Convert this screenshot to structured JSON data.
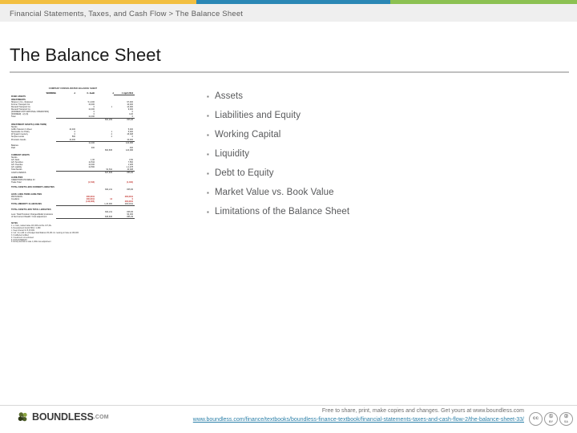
{
  "topbar": {
    "segments": [
      {
        "name": "yellow",
        "color": "#f2bf41"
      },
      {
        "name": "blue",
        "color": "#2b87b5"
      },
      {
        "name": "green",
        "color": "#8cc152"
      }
    ]
  },
  "breadcrumb": {
    "text": "Financial Statements, Taxes, and Cash Flow > The Balance Sheet"
  },
  "page_title": "The Balance Sheet",
  "bullets": [
    {
      "marker": "▪",
      "label": "Assets"
    },
    {
      "marker": "▪",
      "label": "Liabilities and Equity"
    },
    {
      "marker": "▪",
      "label": "Working Capital"
    },
    {
      "marker": "▪",
      "label": "Liquidity"
    },
    {
      "marker": "▪",
      "label": "Debt to Equity"
    },
    {
      "marker": "▪",
      "label": "Market Value vs. Book Value"
    },
    {
      "marker": "▪",
      "label": "Limitations of the Balance Sheet"
    }
  ],
  "figure": {
    "caption": "COMPANY CONSOLIDATED BALANCE SHEET",
    "column_headers": {
      "label": "WORKING",
      "c1": "£",
      "c2": "C. Audit",
      "c3": "£",
      "c4": "1 April 2014"
    },
    "sections": [
      {
        "heading": "FIXED ASSETS",
        "rows": [
          {
            "label": "INVESTMENTS",
            "c1": "",
            "c2": "",
            "c3": "",
            "c4": "",
            "bold": true
          },
          {
            "label": "Shares in Co - Reduced",
            "c1": "",
            "c2": "5,1,400",
            "c3": "",
            "c4": "97,400"
          },
          {
            "label": "Former Transport Co.",
            "c1": "",
            "c2": "12,400",
            "c3": "",
            "c4": "10,400"
          },
          {
            "label": "Renault Transport Co.",
            "c1": "",
            "c2": "0",
            "c3": "1",
            "c4": "14,000"
          },
          {
            "label": "Renault Transport Co.",
            "c1": "",
            "c2": "12,400",
            "c3": "",
            "c4": "9,400"
          },
          {
            "label": "[FORMER UNIT RATIONAL OPERATION]",
            "c1": "",
            "c2": "0",
            "c3": "",
            "c4": "0"
          },
          {
            "label": "[FORMER] - (2) (3)",
            "c1": "",
            "c2": "0",
            "c3": "",
            "c4": "0,20"
          },
          {
            "label": "Total",
            "c1": "",
            "c2": "12,400",
            "c3": "",
            "c4": "0",
            "underline": true
          },
          {
            "label": "",
            "c1": "",
            "c2": "",
            "c3": "804,299",
            "c4": "805,98"
          }
        ]
      },
      {
        "heading": "INVESTMENT ASSETS (LONG TERM)",
        "rows": [
          {
            "label": "Stocks",
            "c1": "",
            "c2": "",
            "c3": "",
            "c4": ""
          },
          {
            "label": "Griffin Telecom In Fleet",
            "c1": "10,400",
            "c2": "",
            "c3": "",
            "c4": "5,400"
          },
          {
            "label": "Newcastle Inv Policy",
            "c1": "0",
            "c2": "",
            "c3": "1",
            "c4": "5,400"
          },
          {
            "label": "W Quant Inventory",
            "c1": "0",
            "c2": "",
            "c3": "2",
            "c4": "15,008"
          },
          {
            "label": "Surplus Lands",
            "c1": "500",
            "c2": "",
            "c3": "2",
            "c4": "0"
          },
          {
            "label": "Provision Goods",
            "c1": "12,400",
            "c2": "",
            "c3": "",
            "c4": "10,400",
            "underline": true
          },
          {
            "label": "",
            "c1": "",
            "c2": "11,400",
            "c3": "",
            "c4": "124,096"
          },
          {
            "label": "Balance",
            "c1": "",
            "c2": "",
            "c3": "",
            "c4": ""
          },
          {
            "label": "Paid",
            "c1": "",
            "c2": "400",
            "c3": "",
            "c4": "400"
          },
          {
            "label": "",
            "c1": "",
            "c2": "",
            "c3": "804,845",
            "c4": "124,096"
          }
        ]
      },
      {
        "heading": "CURRENT ASSETS",
        "rows": [
          {
            "label": "Stocks",
            "c1": "",
            "c2": "",
            "c3": "",
            "c4": ""
          },
          {
            "label": "A/C Debt",
            "c1": "",
            "c2": "1,00",
            "c3": "",
            "c4": "0,50"
          },
          {
            "label": "A/C Sundries",
            "c1": "",
            "c2": "11,544",
            "c3": "",
            "c4": "7,500"
          },
          {
            "label": "A/C Overdue",
            "c1": "",
            "c2": "12,400",
            "c3": "",
            "c4": "1,025"
          },
          {
            "label": "A/C Liability",
            "c1": "",
            "c2": "12,500",
            "c3": "",
            "c4": "1,1,278"
          },
          {
            "label": "Total Stocks",
            "c1": "",
            "c2": "",
            "c3": "91,811",
            "c4": "10,008",
            "underline": true
          },
          {
            "label": "CASH & BANKS",
            "c1": "",
            "c2": "",
            "c3": "847,845",
            "c4": "855,96"
          }
        ]
      },
      {
        "heading": "LIABILITIES",
        "rows": [
          {
            "label": "CREDITORS PAYABLE IN",
            "c1": "",
            "c2": "",
            "c3": "",
            "c4": ""
          },
          {
            "label": "Trade Total",
            "c1": "",
            "c2": "(1,544)",
            "c3": "",
            "c4": "(1,404)",
            "red": true
          }
        ]
      },
      {
        "heading": "TOTAL ASSETS LESS CURRENT LIABILITIES",
        "rows": [
          {
            "label": "",
            "c1": "",
            "c2": "",
            "c3": "824,211",
            "c4": "845,96",
            "bold": true
          }
        ]
      },
      {
        "heading": "LESS: LONG TERM LIABILITIES",
        "rows": [
          {
            "label": "PROVISION",
            "c1": "",
            "c2": "200,0011",
            "c3": "",
            "c4": "200,0011",
            "red": true
          },
          {
            "label": "Creditors",
            "c1": "",
            "c2": "200,0011",
            "c3": "14",
            "c4": "0",
            "red": true
          },
          {
            "label": "",
            "c1": "",
            "c2": "(140,005)",
            "c3": "",
            "c4": "200,0011",
            "red": true
          },
          {
            "label": "TOTAL MINORITY CLAIM BASIS",
            "c1": "",
            "c2": "",
            "c3": "1,20,000",
            "c4": "200,0011",
            "bold": true,
            "underline": true
          }
        ]
      },
      {
        "heading": "TOTAL ASSETS LESS TOTAL LIABILITIES",
        "rows": [
          {
            "label": "",
            "c1": "",
            "c2": "",
            "c3": "824,211",
            "c4": "845,96",
            "bold": true
          },
          {
            "label": "Less: Total Provision Charges/Relief provisions",
            "c1": "",
            "c2": "",
            "c3": "",
            "c4": "90,182"
          },
          {
            "label": "of Net Current Wealth / Cost adjustment",
            "c1": "",
            "c2": "",
            "c3": "845,845",
            "c4": "855,45",
            "underline": true
          }
        ]
      }
    ],
    "notes_heading": "NOTES",
    "notes": [
      "1.  a.  Cars, related value 116,400 and the 417,20+",
      "        b.  Development bonds 500u / 1,399",
      "        c.  Keep interest for 8,15,399",
      "2.  Incl. 11,1,440 on unhedged loan/balance 60,401 inc. leaving on base at 190,400",
      "3.  Unaffected notified",
      "4.  Investment not endorsed",
      "5.  NON-INTEREST",
      "6.  Extra potential on sale 1,100u loss adjustment"
    ]
  },
  "footer": {
    "logo_text": "BOUNDLESS",
    "logo_tld": ".COM",
    "free_line": "Free to share, print, make copies and changes. Get yours at www.boundless.com",
    "url": "www.boundless.com/finance/textbooks/boundless-finance-textbook/financial-statements-taxes-and-cash-flow-2/the-balance-sheet-33/",
    "cc_badges": [
      {
        "glyph": "cc",
        "sub": ""
      },
      {
        "glyph": "①",
        "sub": "BY"
      },
      {
        "glyph": "②",
        "sub": "SA"
      }
    ]
  }
}
